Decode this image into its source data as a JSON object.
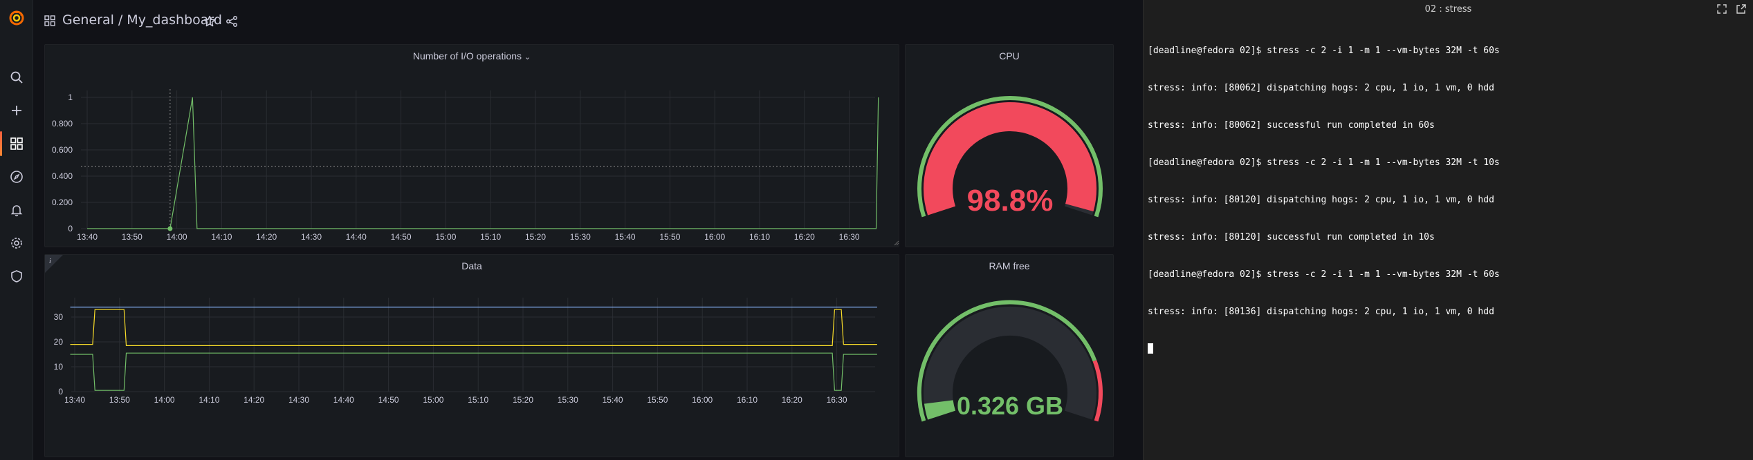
{
  "topbar": {
    "breadcrumb_folder": "General",
    "breadcrumb_separator": "/",
    "breadcrumb_dashboard": "My_dashboard"
  },
  "sidebar": {
    "items": [
      "search",
      "create",
      "dashboards",
      "explore",
      "alerting",
      "configuration",
      "server-admin"
    ]
  },
  "colors": {
    "series_green": "#73bf69",
    "series_yellow": "#fade2a",
    "series_blue": "#8ab8ff",
    "gauge_red": "#f2495c",
    "accent_orange": "#f55f3e"
  },
  "panels": {
    "io": {
      "title": "Number of I/O operations",
      "title_chevron": "⌄"
    },
    "cpu": {
      "title": "CPU",
      "value": "98.8%"
    },
    "data": {
      "title": "Data",
      "info_icon": "i"
    },
    "ram": {
      "title": "RAM free",
      "value": "0.326 GB"
    }
  },
  "chart_data": [
    {
      "type": "line",
      "title": "Number of I/O operations",
      "x": [
        "13:40",
        "13:50",
        "14:00",
        "14:10",
        "14:20",
        "14:30",
        "14:40",
        "14:50",
        "15:00",
        "15:10",
        "15:20",
        "15:30",
        "15:40",
        "15:50",
        "16:00",
        "16:10",
        "16:20",
        "16:30"
      ],
      "y_ticks": [
        "0",
        "0.200",
        "0.400",
        "0.600",
        "0.800",
        "1"
      ],
      "ylim": [
        0,
        1
      ],
      "series": [
        {
          "values": [
            [
              0,
              0
            ],
            [
              1.85,
              0
            ],
            [
              2.35,
              1
            ],
            [
              2.45,
              0
            ],
            [
              17.6,
              0
            ],
            [
              17.65,
              1
            ]
          ]
        }
      ],
      "grid": true
    },
    {
      "type": "line",
      "title": "Data",
      "x": [
        "13:40",
        "13:50",
        "14:00",
        "14:10",
        "14:20",
        "14:30",
        "14:40",
        "14:50",
        "15:00",
        "15:10",
        "15:20",
        "15:30",
        "15:40",
        "15:50",
        "16:00",
        "16:10",
        "16:20",
        "16:30"
      ],
      "y_ticks": [
        "0",
        "10",
        "20",
        "30"
      ],
      "ylim": [
        0,
        35
      ],
      "series": [
        {
          "color": "yellow",
          "values": [
            [
              -0.1,
              19
            ],
            [
              0.4,
              19
            ],
            [
              0.45,
              33
            ],
            [
              1.1,
              33
            ],
            [
              1.15,
              18.5
            ],
            [
              16.9,
              18.5
            ],
            [
              16.95,
              33
            ],
            [
              17.1,
              33
            ],
            [
              17.15,
              19
            ],
            [
              17.9,
              19
            ]
          ]
        },
        {
          "color": "green",
          "values": [
            [
              -0.1,
              15
            ],
            [
              0.4,
              15
            ],
            [
              0.45,
              0.5
            ],
            [
              1.1,
              0.5
            ],
            [
              1.15,
              15.5
            ],
            [
              16.9,
              15.5
            ],
            [
              16.95,
              0.5
            ],
            [
              17.1,
              0.5
            ],
            [
              17.15,
              15
            ],
            [
              17.9,
              15
            ]
          ]
        },
        {
          "color": "blue",
          "values": [
            [
              -0.1,
              34
            ],
            [
              17.9,
              34
            ]
          ]
        }
      ],
      "grid": true
    },
    {
      "type": "gauge",
      "title": "CPU",
      "value": 98.8,
      "unit": "%"
    },
    {
      "type": "gauge",
      "title": "RAM free",
      "value": 0.326,
      "unit": "GB"
    }
  ],
  "terminal": {
    "title": "02 : stress",
    "lines": [
      "[deadline@fedora 02]$ stress -c 2 -i 1 -m 1 --vm-bytes 32M -t 60s",
      "stress: info: [80062] dispatching hogs: 2 cpu, 1 io, 1 vm, 0 hdd",
      "stress: info: [80062] successful run completed in 60s",
      "[deadline@fedora 02]$ stress -c 2 -i 1 -m 1 --vm-bytes 32M -t 10s",
      "stress: info: [80120] dispatching hogs: 2 cpu, 1 io, 1 vm, 0 hdd",
      "stress: info: [80120] successful run completed in 10s",
      "[deadline@fedora 02]$ stress -c 2 -i 1 -m 1 --vm-bytes 32M -t 60s",
      "stress: info: [80136] dispatching hogs: 2 cpu, 1 io, 1 vm, 0 hdd"
    ]
  }
}
